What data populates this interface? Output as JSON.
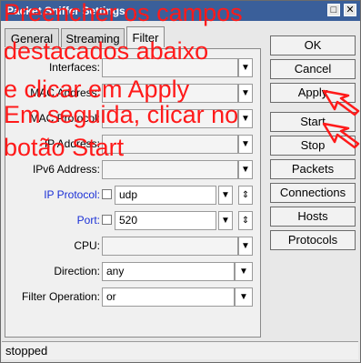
{
  "window": {
    "title": "Packet Sniffer Settings",
    "minimize_glyph": "□",
    "close_glyph": "✕"
  },
  "tabs": [
    {
      "label": "General"
    },
    {
      "label": "Streaming"
    },
    {
      "label": "Filter",
      "active": true
    }
  ],
  "form": {
    "interfaces": {
      "label": "Interfaces:",
      "value": ""
    },
    "mac_address": {
      "label": "MAC Address:",
      "value": ""
    },
    "mac_protocol": {
      "label": "MAC Protocol:",
      "value": ""
    },
    "ip_address": {
      "label": "IP Address:",
      "value": ""
    },
    "ipv6_address": {
      "label": "IPv6 Address:",
      "value": ""
    },
    "ip_protocol": {
      "label": "IP Protocol:",
      "value": "udp"
    },
    "port": {
      "label": "Port:",
      "value": "520"
    },
    "cpu": {
      "label": "CPU:",
      "value": ""
    },
    "direction": {
      "label": "Direction:",
      "value": "any"
    },
    "filter_operation": {
      "label": "Filter Operation:",
      "value": "or"
    }
  },
  "buttons": {
    "ok": "OK",
    "cancel": "Cancel",
    "apply": "Apply",
    "start": "Start",
    "stop": "Stop",
    "packets": "Packets",
    "connections": "Connections",
    "hosts": "Hosts",
    "protocols": "Protocols"
  },
  "status": "stopped",
  "annotation": {
    "lines": [
      "Preencher os campos",
      "destacados abaixo",
      "e clicar  em Apply",
      "Em seguida, clicar no",
      "botão Start"
    ],
    "color": "#ff1a1a"
  },
  "icons": {
    "dropdown": "chevron-down-icon",
    "updown": "up-down-arrow-icon"
  }
}
